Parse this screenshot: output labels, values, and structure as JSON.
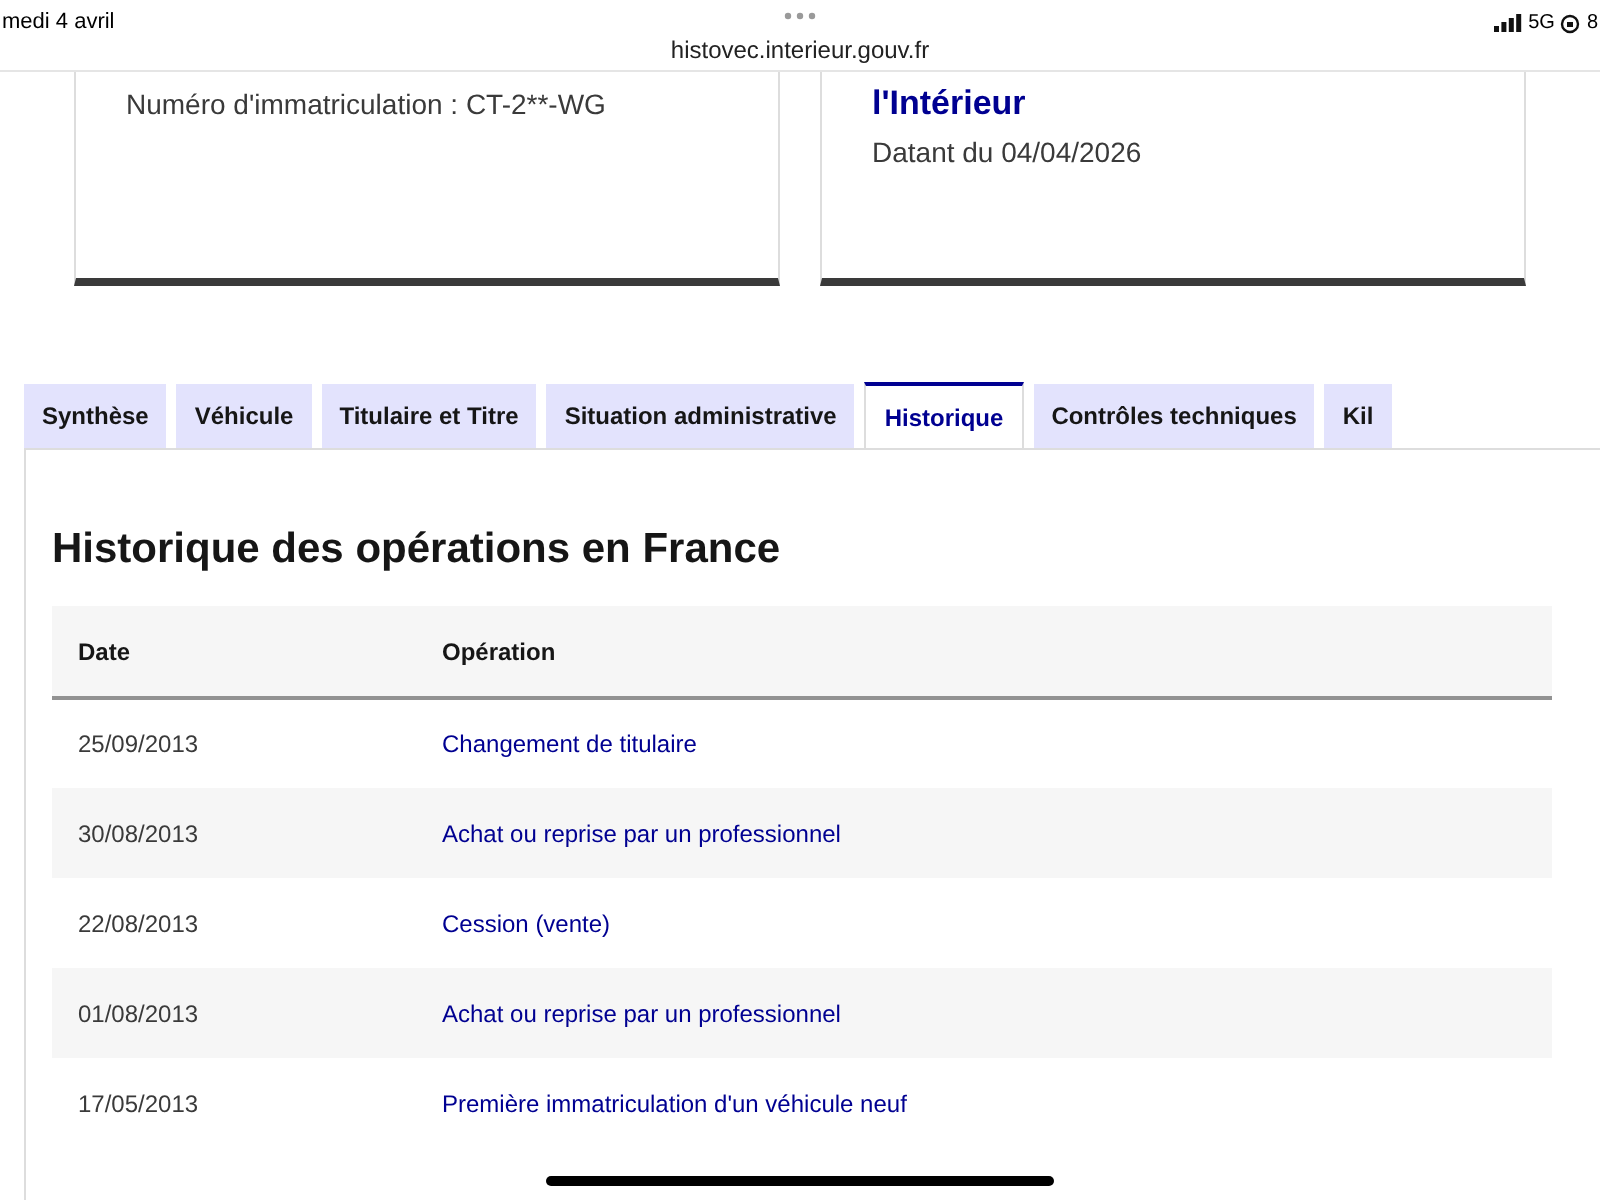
{
  "status_bar": {
    "date": "medi 4 avril",
    "network": "5G",
    "battery": "8"
  },
  "address_bar": {
    "url": "histovec.interieur.gouv.fr"
  },
  "cards": [
    {
      "lines": [
        {
          "kind": "text",
          "text": "Numéro d'immatriculation : CT-2**-WG"
        }
      ]
    },
    {
      "lines": [
        {
          "kind": "title",
          "text": "l'Intérieur"
        },
        {
          "kind": "text",
          "text": "Datant du 04/04/2026"
        }
      ]
    }
  ],
  "tabs": [
    {
      "label": "Synthèse",
      "selected": false
    },
    {
      "label": "Véhicule",
      "selected": false
    },
    {
      "label": "Titulaire et Titre",
      "selected": false
    },
    {
      "label": "Situation administrative",
      "selected": false
    },
    {
      "label": "Historique",
      "selected": true
    },
    {
      "label": "Contrôles techniques",
      "selected": false
    },
    {
      "label": "Kil",
      "selected": false
    }
  ],
  "section": {
    "title": "Historique des opérations en France"
  },
  "table": {
    "columns": [
      "Date",
      "Opération"
    ],
    "rows": [
      [
        "25/09/2013",
        "Changement de titulaire"
      ],
      [
        "30/08/2013",
        "Achat ou reprise par un professionnel"
      ],
      [
        "22/08/2013",
        "Cession (vente)"
      ],
      [
        "01/08/2013",
        "Achat ou reprise par un professionnel"
      ],
      [
        "17/05/2013",
        "Première immatriculation d'un véhicule neuf"
      ]
    ]
  }
}
